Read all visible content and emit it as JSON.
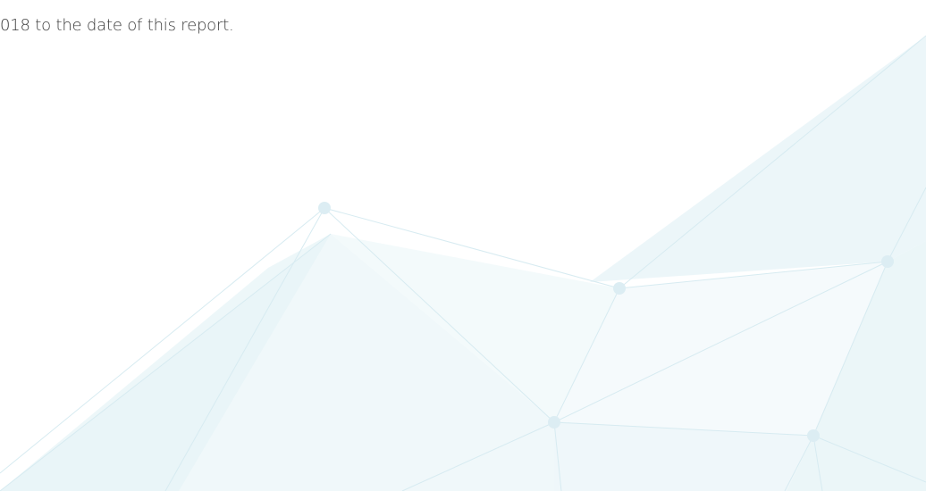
{
  "document": {
    "clipped_line_text": "",
    "body_line": "018 to the date of this report."
  },
  "decoration": {
    "name": "network-background",
    "accent_color": "#e3f1f5",
    "node_color": "#d8ecf2",
    "line_color": "#d6eaf0"
  }
}
